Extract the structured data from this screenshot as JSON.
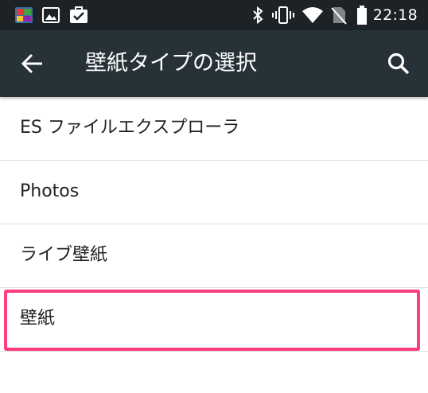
{
  "status_bar": {
    "time": "22:18",
    "left_icons": [
      "app-icon",
      "image-icon",
      "briefcase-check-icon"
    ],
    "right_icons": [
      "bluetooth-icon",
      "vibrate-icon",
      "wifi-icon",
      "no-sim-icon",
      "battery-icon"
    ]
  },
  "app_bar": {
    "title": "壁紙タイプの選択",
    "back_icon": "arrow-back-icon",
    "search_icon": "search-icon",
    "background": "#263238"
  },
  "list": {
    "items": [
      {
        "label": "ES ファイルエクスプローラ"
      },
      {
        "label": "Photos"
      },
      {
        "label": "ライブ壁紙"
      },
      {
        "label": "壁紙"
      }
    ]
  },
  "highlight": {
    "target": "壁紙",
    "color": "#ff3d7f"
  }
}
